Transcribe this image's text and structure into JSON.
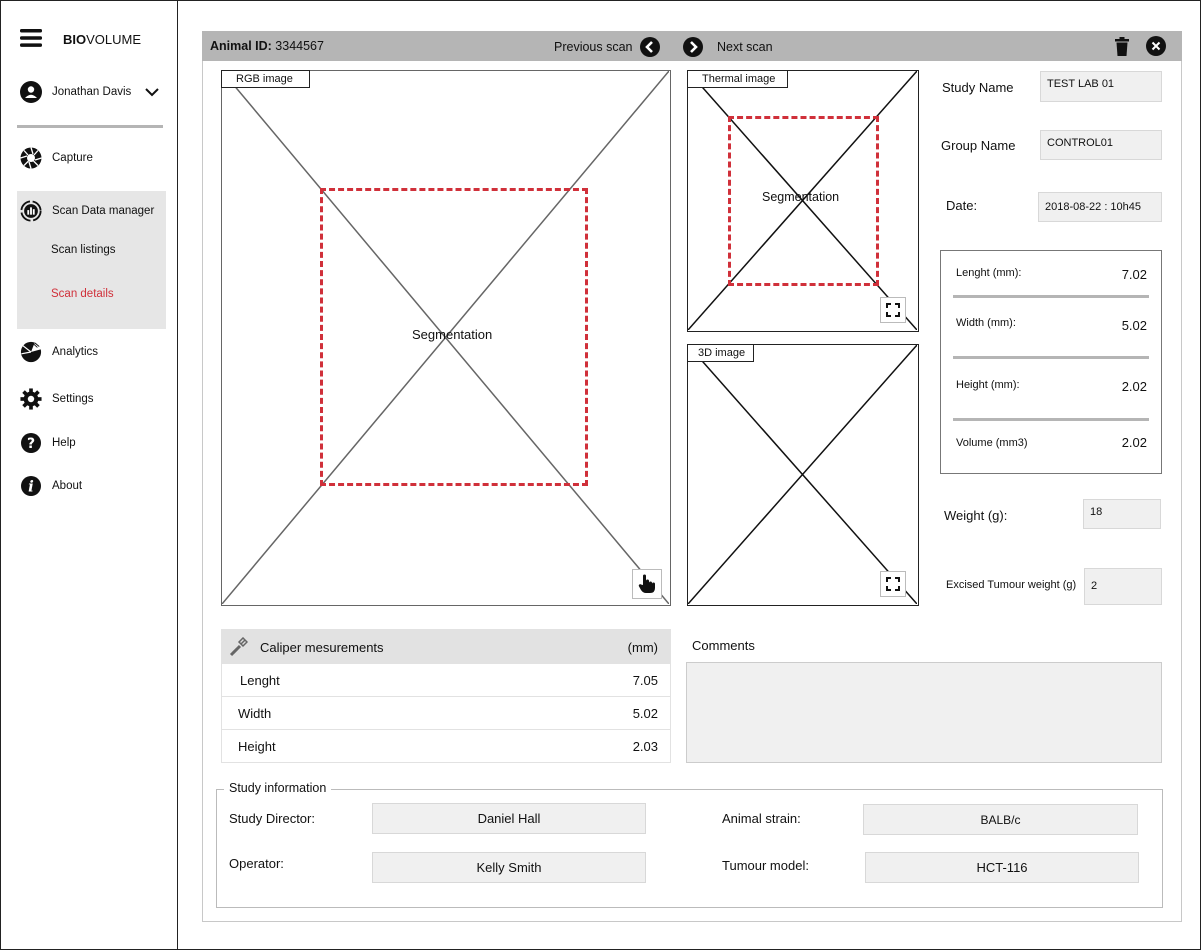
{
  "app": {
    "brand_bold": "BIO",
    "brand_rest": "VOLUME"
  },
  "user": {
    "name": "Jonathan Davis"
  },
  "nav": {
    "capture": "Capture",
    "scan_data_manager": "Scan Data manager",
    "scan_listings": "Scan listings",
    "scan_details": "Scan details",
    "analytics": "Analytics",
    "settings": "Settings",
    "help": "Help",
    "about": "About"
  },
  "toolbar": {
    "animal_id_label": "Animal ID:",
    "animal_id_value": "3344567",
    "prev_scan": "Previous scan",
    "next_scan": "Next scan"
  },
  "images": {
    "rgb_label": "RGB image",
    "rgb_segmentation": "Segmentation",
    "thermal_label": "Thermal  image",
    "thermal_segmentation": "Segmentation",
    "image_3d_label": "3D image"
  },
  "study": {
    "study_name_label": "Study Name",
    "study_name_value": "TEST LAB 01",
    "group_name_label": "Group Name",
    "group_name_value": "CONTROL01",
    "date_label": "Date:",
    "date_value": "2018-08-22 : 10h45"
  },
  "measurements": {
    "length_label": "Lenght (mm):",
    "length_value": "7.02",
    "width_label": "Width (mm):",
    "width_value": "5.02",
    "height_label": "Height (mm):",
    "height_value": "2.02",
    "volume_label": "Volume (mm3)",
    "volume_value": "2.02"
  },
  "weight": {
    "label": "Weight (g):",
    "value": "18"
  },
  "excised": {
    "label": "Excised Tumour weight (g)",
    "value": "2"
  },
  "caliper": {
    "title": "Caliper mesurements",
    "unit": "(mm)",
    "rows": [
      {
        "label": "Lenght",
        "value": "7.05"
      },
      {
        "label": "Width",
        "value": "5.02"
      },
      {
        "label": "Height",
        "value": "2.03"
      }
    ]
  },
  "comments": {
    "label": "Comments",
    "value": ""
  },
  "study_info": {
    "title": "Study information",
    "director_label": "Study Director:",
    "director_value": "Daniel Hall",
    "operator_label": "Operator:",
    "operator_value": "Kelly Smith",
    "strain_label": "Animal strain:",
    "strain_value": "BALB/c",
    "tumour_label": "Tumour model:",
    "tumour_value": "HCT-116"
  },
  "colors": {
    "accent_red": "#d0303a",
    "toolbar_gray": "#b5b5b5",
    "field_bg": "#f0f0f0"
  }
}
